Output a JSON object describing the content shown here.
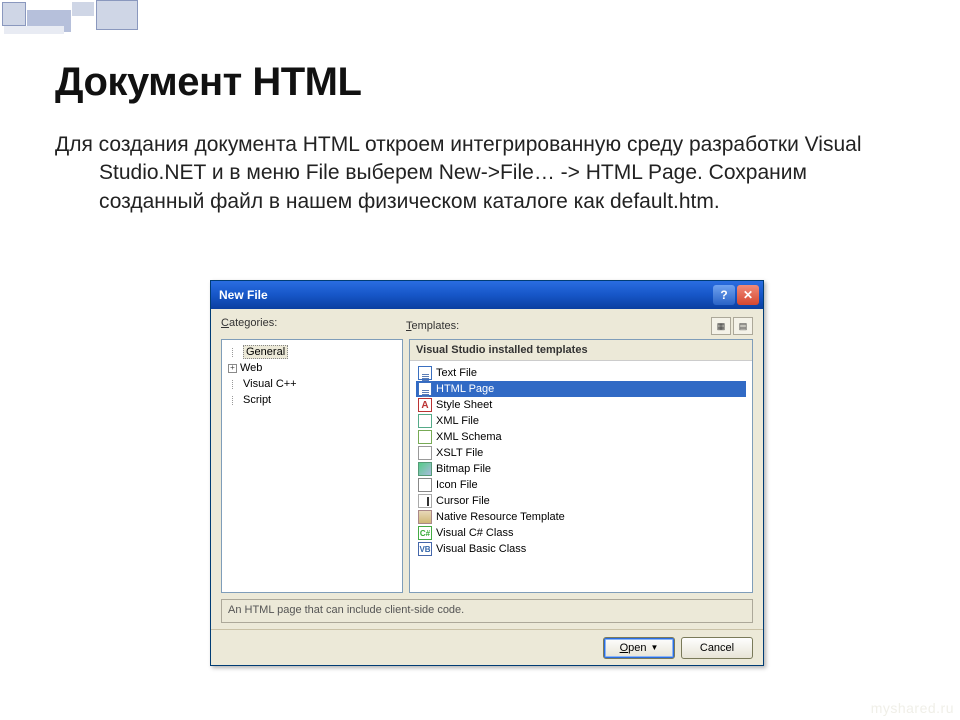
{
  "slide": {
    "heading": "Документ HTML",
    "body": "Для создания документа HTML откроем интегрированную среду разработки Visual Studio.NET и в меню File выберем New->File… -> HTML Page. Сохраним созданный файл в нашем физическом каталоге как default.htm."
  },
  "dialog": {
    "title": "New File",
    "labels": {
      "categories": "Categories:",
      "categories_hotkey": "C",
      "templates": "Templates:",
      "templates_hotkey": "T"
    },
    "categories": [
      {
        "label": "General",
        "expandable": false,
        "expanded": false,
        "selected": true,
        "indent": 0
      },
      {
        "label": "Web",
        "expandable": true,
        "expanded": false,
        "selected": false,
        "indent": 0
      },
      {
        "label": "Visual C++",
        "expandable": false,
        "expanded": false,
        "selected": false,
        "indent": 0
      },
      {
        "label": "Script",
        "expandable": false,
        "expanded": false,
        "selected": false,
        "indent": 0
      }
    ],
    "templates_header": "Visual Studio installed templates",
    "templates": [
      {
        "label": "Text File",
        "icon": "page",
        "selected": false
      },
      {
        "label": "HTML Page",
        "icon": "page",
        "selected": true
      },
      {
        "label": "Style Sheet",
        "icon": "style",
        "selected": false
      },
      {
        "label": "XML File",
        "icon": "xml",
        "selected": false
      },
      {
        "label": "XML Schema",
        "icon": "schema",
        "selected": false
      },
      {
        "label": "XSLT File",
        "icon": "xslt",
        "selected": false
      },
      {
        "label": "Bitmap File",
        "icon": "bmp",
        "selected": false
      },
      {
        "label": "Icon File",
        "icon": "icon",
        "selected": false
      },
      {
        "label": "Cursor File",
        "icon": "cursor",
        "selected": false
      },
      {
        "label": "Native Resource Template",
        "icon": "native",
        "selected": false
      },
      {
        "label": "Visual C# Class",
        "icon": "cs",
        "selected": false
      },
      {
        "label": "Visual Basic Class",
        "icon": "vb",
        "selected": false
      }
    ],
    "description": "An HTML page that can include client-side code.",
    "buttons": {
      "open": "Open",
      "open_hotkey": "O",
      "cancel": "Cancel"
    }
  },
  "watermark": "myshared.ru"
}
